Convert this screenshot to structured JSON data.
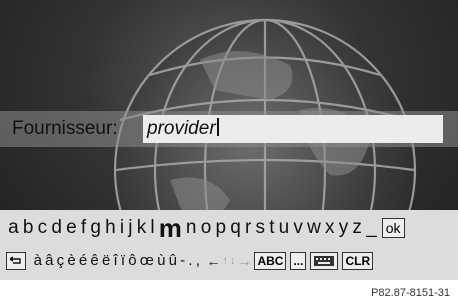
{
  "input": {
    "label": "Fournisseur:",
    "value": "provider"
  },
  "keyboard": {
    "letters": [
      "a",
      "b",
      "c",
      "d",
      "e",
      "f",
      "g",
      "h",
      "i",
      "j",
      "k",
      "l",
      "m",
      "n",
      "o",
      "p",
      "q",
      "r",
      "s",
      "t",
      "u",
      "v",
      "w",
      "x",
      "y",
      "z",
      "_"
    ],
    "selected_letter": "m",
    "ok_label": "ok",
    "back_icon": "back-icon",
    "special_chars": [
      "à",
      "â",
      "ç",
      "è",
      "é",
      "ê",
      "ë",
      "î",
      "ï",
      "ô",
      "œ",
      "ù",
      "û",
      "-",
      ".",
      ","
    ],
    "arrows": {
      "left": "←",
      "up": "↑",
      "down": "↓",
      "right": "→"
    },
    "abc_label": "ABC",
    "more_label": "...",
    "clr_label": "CLR"
  },
  "reference": "P82.87-8151-31"
}
